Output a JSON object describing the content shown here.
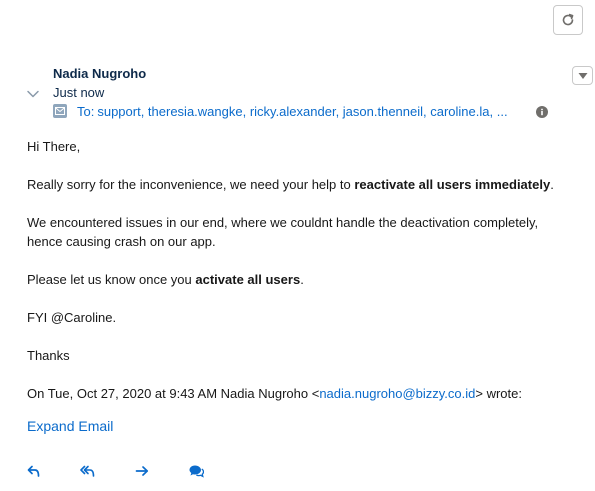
{
  "email": {
    "sender_name": "Nadia Nugroho",
    "timestamp": "Just now",
    "to_label": "To:",
    "recipients": "support, theresia.wangke, ricky.alexander, jason.thenneil, caroline.la, ...",
    "greeting": "Hi There,",
    "p1_before": "Really sorry for the inconvenience, we need your help to ",
    "p1_bold": "reactivate all users immediately",
    "p1_after": ".",
    "p2": "We encountered issues in our end, where we couldnt handle the deactivation completely, hence causing crash on our app.",
    "p3_before": "Please let us know once you ",
    "p3_bold": "activate all users",
    "p3_after": ".",
    "fyi": "FYI @Caroline.",
    "thanks": "Thanks",
    "quote_prefix": "On Tue, Oct 27, 2020 at 9:43 AM Nadia Nugroho <",
    "quote_email": "nadia.nugroho@bizzy.co.id",
    "quote_suffix": "> wrote:",
    "expand_label": "Expand Email"
  },
  "icons": {
    "refresh": "refresh-icon",
    "menu": "dropdown-menu-icon",
    "collapse": "chevron-down-icon",
    "mail": "email-icon",
    "info": "info-icon",
    "reply": "reply-icon",
    "reply_all": "reply-all-icon",
    "forward": "forward-icon",
    "chat": "chat-icon"
  },
  "colors": {
    "link": "#0b6bcb",
    "sender": "#0e2a4a",
    "icon_gray": "#706e6b"
  }
}
